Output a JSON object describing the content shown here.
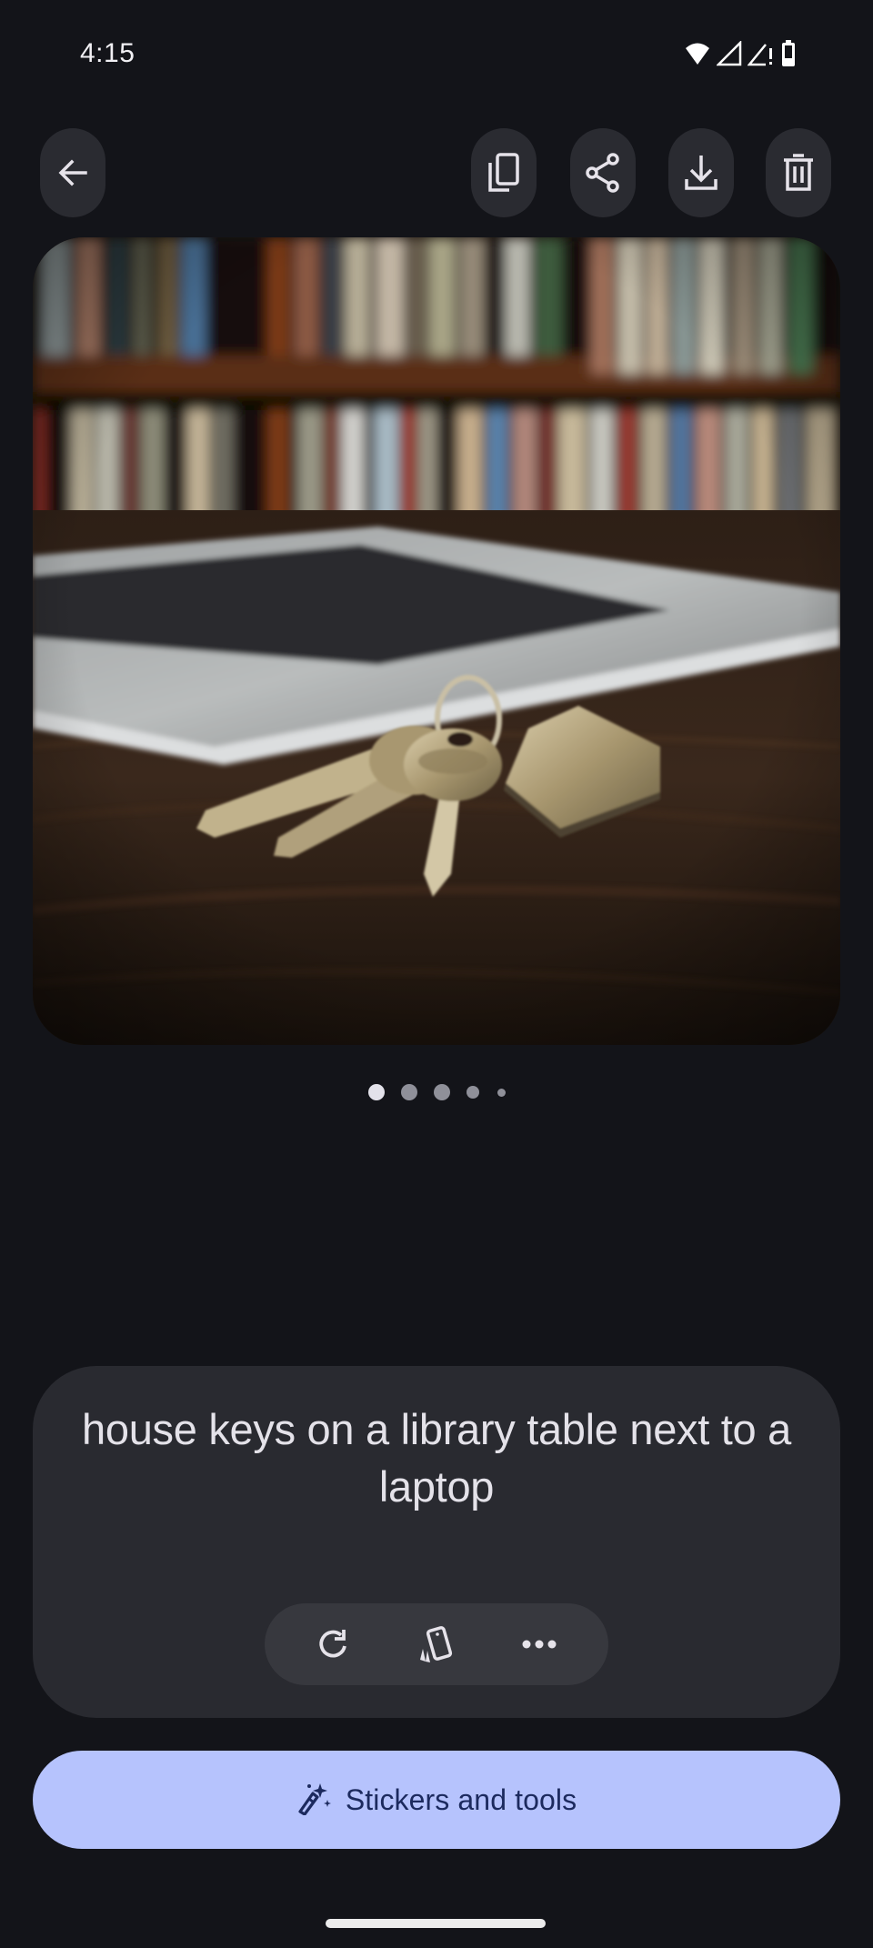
{
  "status_bar": {
    "time": "4:15",
    "icons": [
      "wifi-icon",
      "signal-icon",
      "signal-no-data-icon",
      "battery-icon"
    ]
  },
  "toolbar": {
    "back": {
      "icon": "arrow-back-icon",
      "label": "Back"
    },
    "actions": [
      {
        "icon": "copy-icon",
        "label": "Copy"
      },
      {
        "icon": "share-icon",
        "label": "Share"
      },
      {
        "icon": "download-icon",
        "label": "Download"
      },
      {
        "icon": "delete-icon",
        "label": "Delete"
      }
    ]
  },
  "image": {
    "description": "Generated image: house keys with a house-shaped keychain on a dark wooden library table next to a silver laptop, bookshelves in the background"
  },
  "pagination": {
    "total_visible_dots": 5,
    "current_index": 0
  },
  "prompt": {
    "text": "house keys on a library table next to a laptop",
    "actions": [
      {
        "icon": "refresh-icon",
        "label": "Regenerate"
      },
      {
        "icon": "cards-icon",
        "label": "Variations"
      },
      {
        "icon": "more-horiz-icon",
        "label": "More options"
      }
    ]
  },
  "stickers_button": {
    "icon": "magic-wand-icon",
    "label": "Stickers and tools"
  },
  "colors": {
    "background": "#131419",
    "surface": "#292a30",
    "chip": "#37383e",
    "accent": "#b6c3fd",
    "accent_text": "#1c2a5e"
  }
}
